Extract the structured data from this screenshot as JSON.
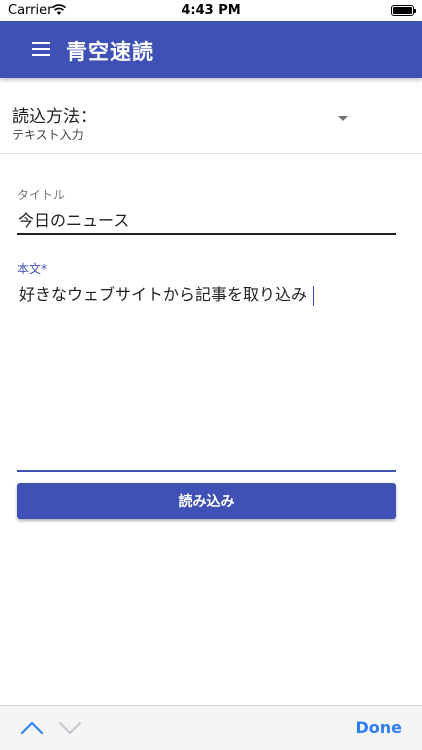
{
  "status_bar": {
    "carrier": "Carrier",
    "time": "4:43 PM"
  },
  "app_bar": {
    "title": "青空速読",
    "menu_icon": "hamburger-menu-icon",
    "color": "#3f51b5"
  },
  "method_select": {
    "label": "読込方法：",
    "value": "テキスト入力",
    "arrow_icon": "dropdown-arrow-icon"
  },
  "title_field": {
    "label": "タイトル",
    "value": "今日のニュース"
  },
  "body_field": {
    "label": "本文*",
    "value": "好きなウェブサイトから記事を取り込み"
  },
  "load_button": {
    "label": "読み込み"
  },
  "keyboard_toolbar": {
    "up_icon": "chevron-up-icon",
    "down_icon": "chevron-down-icon",
    "done_label": "Done",
    "done_color": "#2f7cf6"
  }
}
